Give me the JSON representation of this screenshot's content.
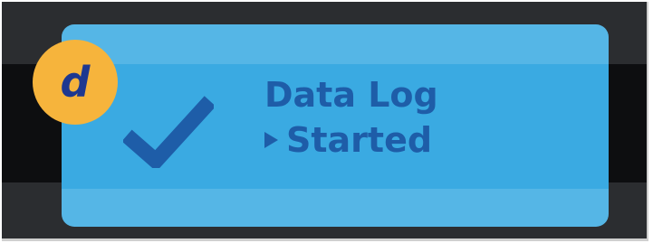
{
  "badge": {
    "letter": "d",
    "color": "#f6b43c"
  },
  "status": {
    "title": "Data Log",
    "state": "Started",
    "icon": "checkmark-icon",
    "state_icon": "play-triangle-icon",
    "card_color": "#3aaae2",
    "text_color": "#1e5da8"
  }
}
